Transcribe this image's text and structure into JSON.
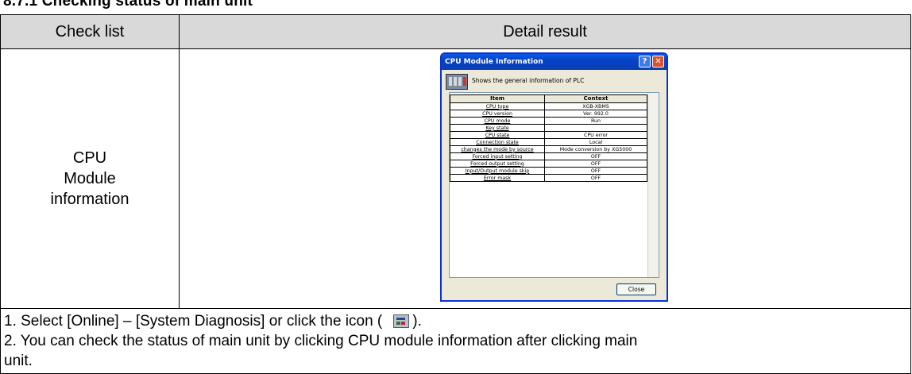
{
  "doc": {
    "heading": "8.7.1 Checking status of main unit",
    "col_check_list": "Check list",
    "col_detail_result": "Detail result",
    "row_label_lines": [
      "CPU",
      "Module",
      "information"
    ],
    "notes": [
      "1. Select [Online] – [System Diagnosis] or click the icon (",
      ").",
      "2. You can check the status of main unit by clicking CPU module information after clicking main",
      "unit."
    ]
  },
  "dialog": {
    "title": "CPU Module Information",
    "help_glyph": "?",
    "close_glyph": "✕",
    "info_text": "Shows the general information of PLC",
    "table_headers": [
      "Item",
      "Context"
    ],
    "rows": [
      {
        "item": "CPU type",
        "context": "XGB-XBMS"
      },
      {
        "item": "CPU version",
        "context": "Ver. 992.0"
      },
      {
        "item": "CPU mode",
        "context": "Run"
      },
      {
        "item": "Key state",
        "context": ""
      },
      {
        "item": "CPU state",
        "context": "CPU error"
      },
      {
        "item": "Connection state",
        "context": "Local"
      },
      {
        "item": "changes the mode by source",
        "context": "Mode conversion by XG5000"
      },
      {
        "item": "Forced input setting",
        "context": "OFF"
      },
      {
        "item": "Forced output setting",
        "context": "OFF"
      },
      {
        "item": "Input/Output module skip",
        "context": "OFF"
      },
      {
        "item": "Error mask",
        "context": "OFF"
      }
    ],
    "close_label": "Close"
  }
}
